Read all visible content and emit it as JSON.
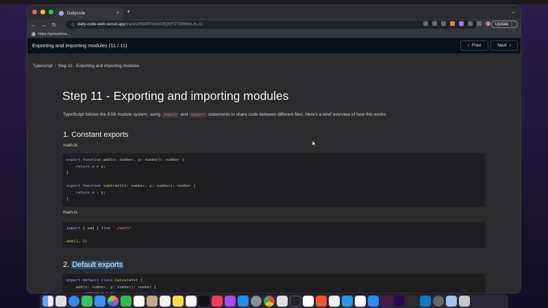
{
  "browser": {
    "tab_title": "Dailycode",
    "url_host": "daily-code-web.vercel.app",
    "url_path": "/tracks/8SbPPXGkG8QKFOTW99mL/ts-11",
    "bookmark_label": "https://getsubmis...",
    "update_label": "Update"
  },
  "page": {
    "nav_title": "Exporting and importing modules (11 / 11)",
    "prev_label": "Prev",
    "next_label": "Next",
    "breadcrumb_root": "Typescript",
    "breadcrumb_sep": "/",
    "breadcrumb_current": "Step 11 - Exporting and importing modules",
    "heading": "Step 11 - Exporting and importing modules",
    "intro_before": "TypeScript follows the ES6 module system, using ",
    "intro_kw1": "import",
    "intro_and": " and ",
    "intro_kw2": "export",
    "intro_after": " statements to share code between different files. Here's a brief overview of how this works:",
    "section1_title": "1. Constant exports",
    "file1": "math.ts",
    "file2": "main.ts",
    "section2_number": "2. ",
    "section2_title": "Default exports"
  },
  "code": {
    "math_ts": [
      "export function add(x: number, y: number): number {",
      "    return x + y;",
      "}",
      "",
      "export function subtract(x: number, y: number): number {",
      "    return x - y;",
      "}"
    ],
    "main_ts": [
      "import { add } from \"./math\"",
      "",
      "add(1, 2)"
    ],
    "default_ts": [
      "export default class Calculator {",
      "    add(x: number, y: number): number {",
      "        return x + y;"
    ]
  },
  "colors": {
    "accent_highlight": "#264f6e",
    "inline_code": "#e06c75",
    "nav_bg": "#0c1117",
    "page_bg": "#2b2b2e"
  }
}
